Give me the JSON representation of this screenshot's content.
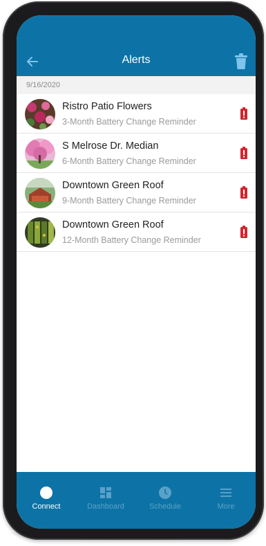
{
  "header": {
    "title": "Alerts",
    "back_icon": "arrow-left-icon",
    "trash_icon": "trash-icon"
  },
  "date_label": "9/16/2020",
  "alerts": [
    {
      "title": "Ristro Patio Flowers",
      "subtitle": "3-Month Battery Change Reminder",
      "avatar": "flowers-photo",
      "status_icon": "battery-low-icon"
    },
    {
      "title": "S Melrose Dr. Median",
      "subtitle": "6-Month Battery Change Reminder",
      "avatar": "blossom-tree-photo",
      "status_icon": "battery-low-icon"
    },
    {
      "title": "Downtown Green Roof",
      "subtitle": "9-Month Battery Change Reminder",
      "avatar": "green-roof-photo",
      "status_icon": "battery-low-icon"
    },
    {
      "title": "Downtown Green Roof",
      "subtitle": "12-Month Battery Change Reminder",
      "avatar": "green-roof-aerial-photo",
      "status_icon": "battery-low-icon"
    }
  ],
  "tabs": [
    {
      "label": "Connect",
      "icon": "connect-dot-icon",
      "active": true
    },
    {
      "label": "Dashboard",
      "icon": "dashboard-icon",
      "active": false
    },
    {
      "label": "Schedule",
      "icon": "clock-icon",
      "active": false
    },
    {
      "label": "More",
      "icon": "hamburger-icon",
      "active": false
    }
  ],
  "colors": {
    "accent": "#0d73a6",
    "battery_alert": "#d0262d",
    "tab_inactive": "#5aa1c8"
  }
}
